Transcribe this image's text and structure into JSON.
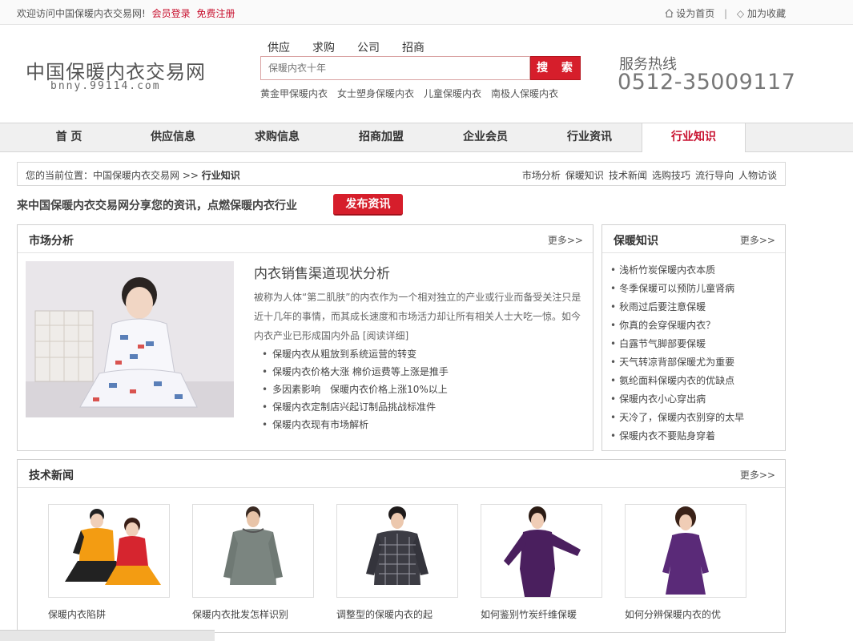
{
  "topbar": {
    "welcome": "欢迎访问中国保暖内衣交易网!",
    "login": "会员登录",
    "register": "免费注册",
    "set_home": "设为首页",
    "add_fav": "加为收藏"
  },
  "logo": {
    "cn": "中国保暖内衣交易网",
    "en": "bnny.99114.com"
  },
  "search": {
    "tabs": [
      "供应",
      "求购",
      "公司",
      "招商"
    ],
    "placeholder": "保暖内衣十年",
    "button": "搜 索",
    "hot_keys": [
      "黄金甲保暖内衣",
      "女士塑身保暖内衣",
      "儿童保暖内衣",
      "南极人保暖内衣"
    ]
  },
  "hotline": {
    "label": "服务热线",
    "number": "0512-35009117"
  },
  "nav": [
    "首 页",
    "供应信息",
    "求购信息",
    "招商加盟",
    "企业会员",
    "行业资讯",
    "行业知识"
  ],
  "breadcrumb": {
    "prefix": "您的当前位置：",
    "home": "中国保暖内衣交易网",
    "sep": ">>",
    "current": "行业知识",
    "quick_links": [
      "市场分析",
      "保暖知识",
      "技术新闻",
      "选购技巧",
      "流行导向",
      "人物访谈"
    ]
  },
  "share": {
    "text": "来中国保暖内衣交易网分享您的资讯，点燃保暖内衣行业",
    "button": "发布资讯"
  },
  "market": {
    "title": "市场分析",
    "more": "更多>>",
    "article_title": "内衣销售渠道现状分析",
    "article_body": "被称为人体“第二肌肤”的内衣作为一个相对独立的产业或行业而备受关注只是近十几年的事情，而其成长速度和市场活力却让所有相关人士大吃一惊。如今 内衣产业已形成国内外品 [阅读详细]",
    "bullets": [
      "保暖内衣从粗放到系统运营的转变",
      "保暖内衣价格大涨 棉价运费等上涨是推手",
      "多因素影响　保暖内衣价格上涨10%以上",
      "保暖内衣定制店兴起订制品挑战标准件",
      "保暖内衣现有市场解析"
    ]
  },
  "knowledge": {
    "title": "保暖知识",
    "more": "更多>>",
    "items": [
      "浅析竹炭保暖内衣本质",
      "冬季保暖可以预防儿童肾病",
      "秋雨过后要注意保暖",
      "你真的会穿保暖内衣？",
      "白露节气脚部要保暖",
      "天气转凉背部保暖尤为重要",
      "氨纶面料保暖内衣的优缺点",
      "保暖内衣小心穿出病",
      "天冷了，保暖内衣别穿的太早",
      "保暖内衣不要贴身穿着"
    ]
  },
  "tech": {
    "title": "技术新闻",
    "more": "更多>>",
    "products": [
      "保暖内衣陷阱",
      "保暖内衣批发怎样识别",
      "调整型的保暖内衣的起",
      "如何鉴别竹炭纤维保暖",
      "如何分辨保暖内衣的优"
    ]
  },
  "colors": {
    "accent": "#d61e2b",
    "nav_active": "#c8102e"
  }
}
